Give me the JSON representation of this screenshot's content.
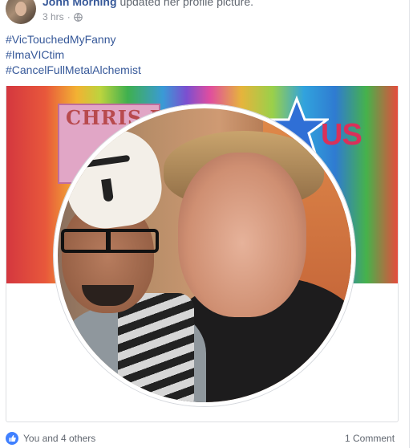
{
  "header": {
    "author": "John Morning",
    "action": "updated her profile picture.",
    "timestamp": "3 hrs",
    "privacy_icon": "globe-icon"
  },
  "post": {
    "hashtags": [
      "#VicTouchedMyFanny",
      "#ImaVICtim",
      "#CancelFullMetalAlchemist"
    ]
  },
  "photo": {
    "cover_sign_text": "CHRIS BEN",
    "cover_logo_text": "US"
  },
  "footer": {
    "reactions_text": "You and 4 others",
    "reaction_icon": "like-icon",
    "comments_text": "1 Comment"
  },
  "colors": {
    "link": "#365899",
    "meta": "#90949c",
    "like_blue": "#4080ff"
  }
}
